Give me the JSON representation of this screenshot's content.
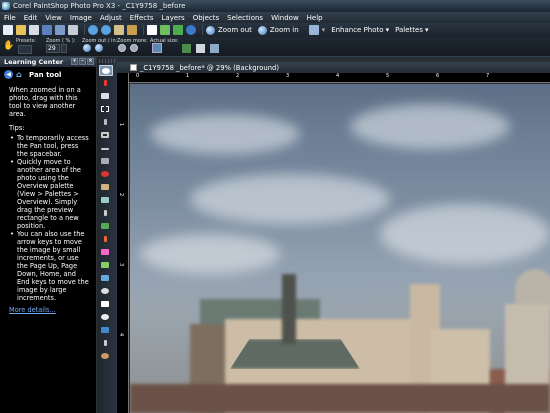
{
  "app": {
    "title": "Corel PaintShop Photo Pro X3 - _C1Y9758 _before"
  },
  "menu": [
    "File",
    "Edit",
    "View",
    "Image",
    "Adjust",
    "Effects",
    "Layers",
    "Objects",
    "Selections",
    "Window",
    "Help"
  ],
  "toolbar": {
    "zoom_out": "Zoom out",
    "zoom_in": "Zoom in",
    "enhance_photo": "Enhance Photo",
    "palettes": "Palettes"
  },
  "tool_options": {
    "presets_label": "Presets:",
    "zoom_label": "Zoom ( % ):",
    "zoom_value": "29",
    "zoom_outin_label": "Zoom out / in:",
    "zoom_more_label": "Zoom more:",
    "actual_size_label": "Actual size:"
  },
  "learning_center": {
    "panel_title": "Learning Center",
    "heading": "Pan tool",
    "intro": "When zoomed in on a photo, drag with this tool to view another area.",
    "tips_label": "Tips:",
    "tips": [
      "To temporarily access the Pan tool, press the spacebar.",
      "Quickly move to another area of the photo using the Overview palette (View > Palettes > Overview). Simply drag the preview rectangle to a new position.",
      "You can also use the arrow keys to move the image by small increments, or use the Page Up, Page Down, Home, and End keys to move the image by large increments."
    ],
    "more_link": "More details..."
  },
  "document": {
    "title": "_C1Y9758 _before* @ 29% (Background)"
  },
  "ruler": {
    "h_labels": [
      "0",
      "1",
      "2",
      "3",
      "4",
      "5",
      "6",
      "7"
    ],
    "v_labels": [
      "1",
      "2",
      "3",
      "4"
    ]
  },
  "icons": [
    "pan-icon",
    "zoom-icon",
    "back-icon",
    "home-icon"
  ]
}
